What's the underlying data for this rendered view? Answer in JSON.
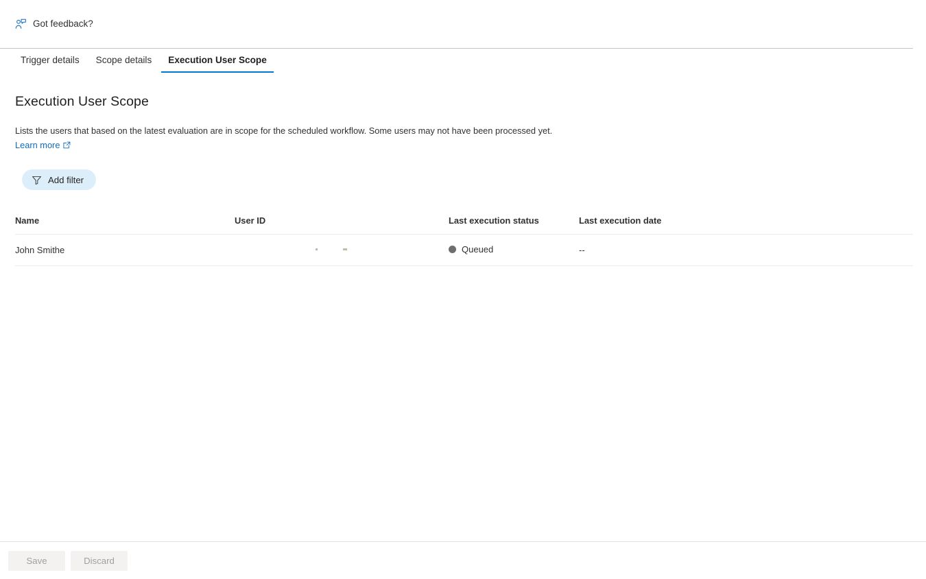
{
  "feedback": {
    "label": "Got feedback?",
    "icon": "feedback-person-icon"
  },
  "tabs": [
    {
      "label": "Trigger details",
      "active": false
    },
    {
      "label": "Scope details",
      "active": false
    },
    {
      "label": "Execution User Scope",
      "active": true
    }
  ],
  "main": {
    "title": "Execution User Scope",
    "description": "Lists the users that based on the latest evaluation are in scope for the scheduled workflow. Some users may not have been processed yet.",
    "learn_more": "Learn more",
    "learn_more_icon": "external-link-icon"
  },
  "toolbar": {
    "add_filter_label": "Add filter",
    "filter_icon": "filter-funnel-icon"
  },
  "table": {
    "columns": [
      "Name",
      "User ID",
      "Last execution status",
      "Last execution date"
    ],
    "rows": [
      {
        "name": "John Smithe",
        "user_id": "",
        "status": "Queued",
        "status_color": "#6e6e6e",
        "date": "--"
      }
    ]
  },
  "footer": {
    "save_label": "Save",
    "discard_label": "Discard"
  },
  "colors": {
    "accent": "#0078d4",
    "link": "#0f6cbd",
    "pill_background": "#ddeefb",
    "status_queued": "#6e6e6e"
  }
}
